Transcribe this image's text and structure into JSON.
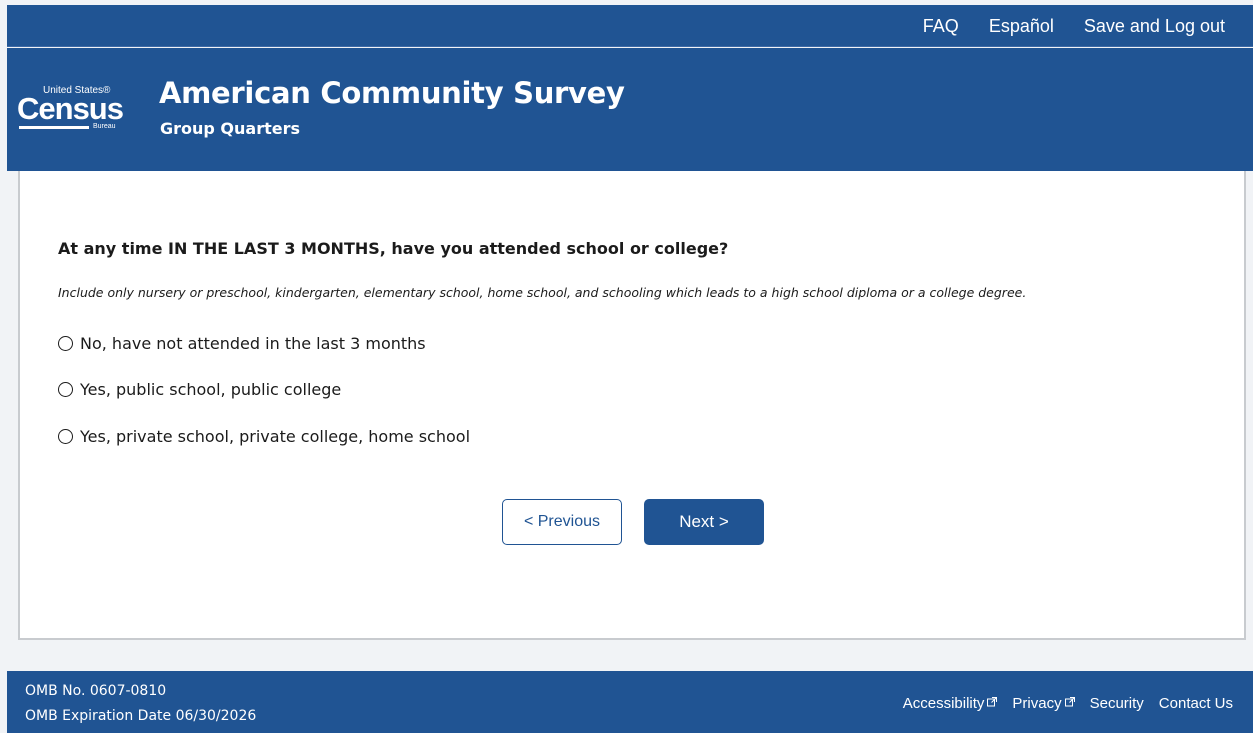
{
  "topnav": {
    "faq": "FAQ",
    "espanol": "Español",
    "logout": "Save and Log out"
  },
  "header": {
    "logo_united_states": "United States®",
    "logo_census": "Census",
    "logo_bureau": "Bureau",
    "title": "American Community Survey",
    "subtitle": "Group Quarters"
  },
  "question": {
    "text": "At any time IN THE LAST 3 MONTHS, have you attended school or college?",
    "instruction": "Include only nursery or preschool, kindergarten, elementary school, home school, and schooling which leads to a high school diploma or a college degree.",
    "options": [
      "No, have not attended in the last 3 months",
      "Yes, public school, public college",
      "Yes, private school, private college, home school"
    ]
  },
  "buttons": {
    "previous": "< Previous",
    "next": "Next >"
  },
  "footer": {
    "omb_number": "OMB No. 0607-0810",
    "omb_expiration": "OMB Expiration Date 06/30/2026",
    "links": [
      "Accessibility",
      "Privacy",
      "Security",
      "Contact Us"
    ]
  },
  "colors": {
    "brand_blue": "#205493",
    "page_bg": "#f1f3f6",
    "panel_border": "#c8cbcf"
  },
  "icons": {
    "external": "external-link-icon",
    "radio": "radio-unchecked-icon"
  }
}
